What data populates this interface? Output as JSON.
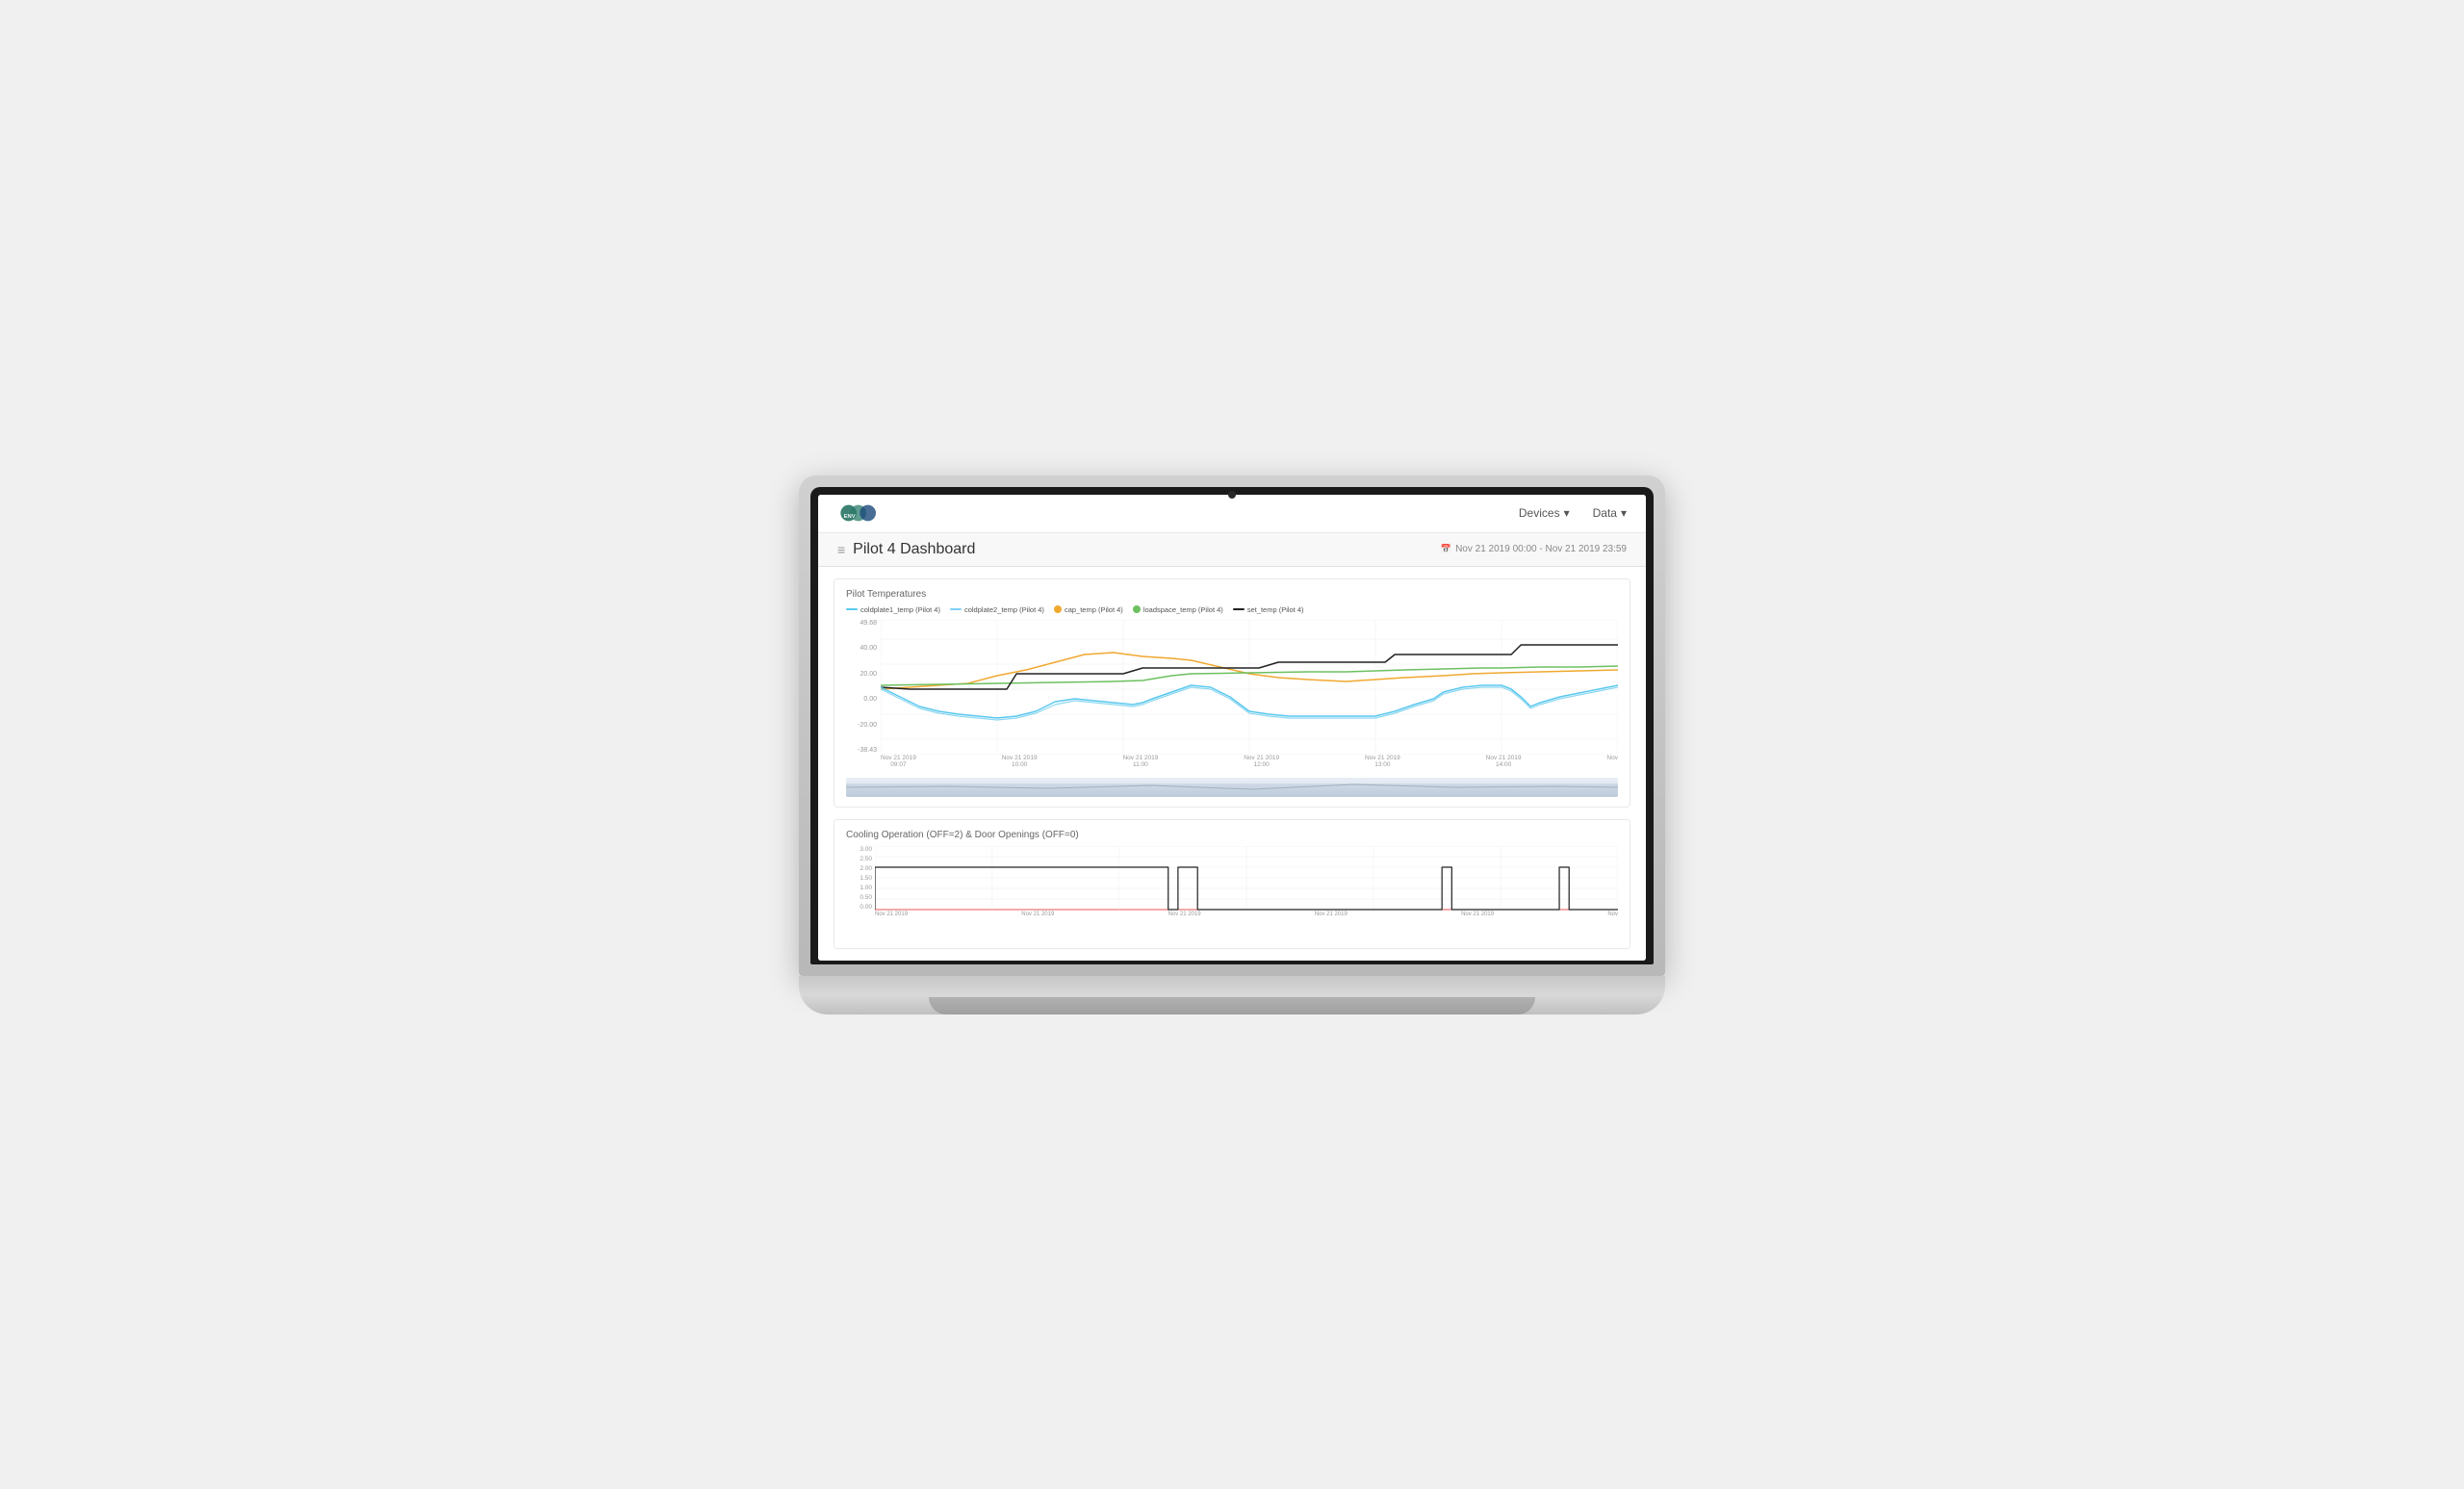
{
  "laptop": {
    "screen": {
      "navbar": {
        "devices_label": "Devices",
        "devices_arrow": "▾",
        "data_label": "Data",
        "data_arrow": "▾"
      },
      "page_header": {
        "hamburger": "≡",
        "title": "Pilot 4 Dashboard",
        "calendar_icon": "📅",
        "date_range": "Nov 21 2019 00:00 - Nov 21 2019 23:59"
      },
      "temp_chart": {
        "title": "Pilot Temperatures",
        "legend": [
          {
            "label": "coldplate1_temp (Pilot 4)",
            "color": "#5bc8ef"
          },
          {
            "label": "coldplate2_temp (Pilot 4)",
            "color": "#7fd1f5"
          },
          {
            "label": "cap_temp (Pilot 4)",
            "color": "#f0a830"
          },
          {
            "label": "loadspace_temp (Pilot 4)",
            "color": "#6dc060"
          },
          {
            "label": "set_temp (Pilot 4)",
            "color": "#222222"
          }
        ],
        "y_labels": [
          "49.68",
          "40.00",
          "20.00",
          "0.00",
          "-20.00",
          "-38.43"
        ],
        "x_labels": [
          {
            "line1": "Nov 21 2019",
            "line2": "09:07"
          },
          {
            "line1": "Nov 21 2019",
            "line2": "10:00"
          },
          {
            "line1": "Nov 21 2019",
            "line2": "11:00"
          },
          {
            "line1": "Nov 21 2019",
            "line2": "12:00"
          },
          {
            "line1": "Nov 21 2019",
            "line2": "13:00"
          },
          {
            "line1": "Nov 21 2019",
            "line2": "14:00"
          },
          {
            "line1": "Nov",
            "line2": ""
          }
        ]
      },
      "cooling_chart": {
        "title": "Cooling Operation (OFF=2) & Door Openings (OFF=0)",
        "y_labels": [
          "3.00",
          "2.50",
          "2.00",
          "1.50",
          "1.00",
          "0.50",
          "0.00"
        ],
        "x_labels": [
          "Nov 21 2019",
          "Nov 21 2019",
          "Nov 21 2019",
          "Nov 21 2019",
          "Nov 21 2019",
          "Nov"
        ]
      }
    }
  }
}
